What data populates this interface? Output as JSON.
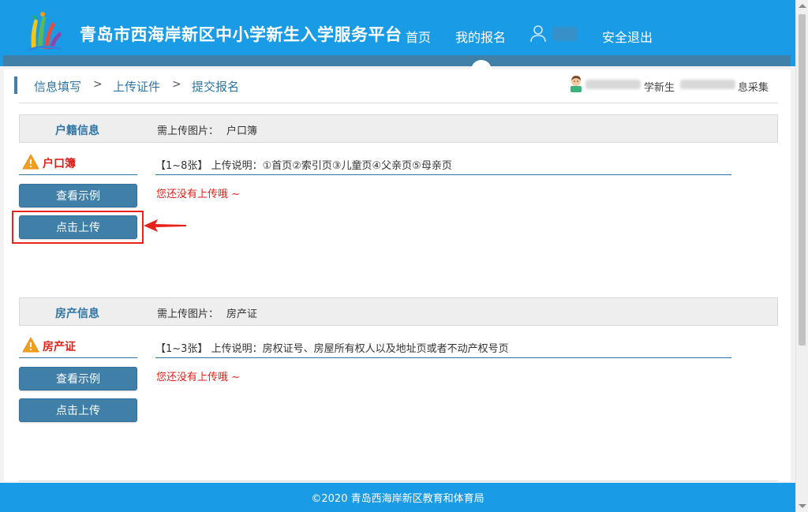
{
  "header": {
    "title": "青岛市西海岸新区中小学新生入学服务平台",
    "nav": {
      "home": "首页",
      "my_registration": "我的报名",
      "logout": "安全退出"
    }
  },
  "breadcrumb": {
    "step1": "信息填写",
    "step2": "上传证件",
    "step3": "提交报名",
    "separator": ">"
  },
  "student_info": {
    "text1": "学新生",
    "text2": "息采集"
  },
  "sections": [
    {
      "title": "户籍信息",
      "required_label": "需上传图片：",
      "required_value": "户口簿",
      "doc_name": "户口簿",
      "description": "【1~8张】 上传说明：①首页②索引页③儿童页④父亲页⑤母亲页",
      "status": "您还没有上传哦 ~",
      "view_example": "查看示例",
      "upload": "点击上传"
    },
    {
      "title": "房产信息",
      "required_label": "需上传图片：",
      "required_value": "房产证",
      "doc_name": "房产证",
      "description": "【1~3张】 上传说明：房权证号、房屋所有权人以及地址页或者不动产权号页",
      "status": "您还没有上传哦 ~",
      "view_example": "查看示例",
      "upload": "点击上传"
    }
  ],
  "footer": {
    "copyright": "©2020 青岛西海岸新区教育和体育局"
  },
  "colors": {
    "header_blue": "#1a9be6",
    "button_blue": "#3f7fa8",
    "link_blue": "#2e75a6",
    "warning_red": "#e0201b",
    "highlight_red": "#e8231b"
  },
  "icons": [
    "app-logo",
    "user-icon",
    "student-avatar-icon",
    "warning-icon",
    "arrow-icon"
  ]
}
